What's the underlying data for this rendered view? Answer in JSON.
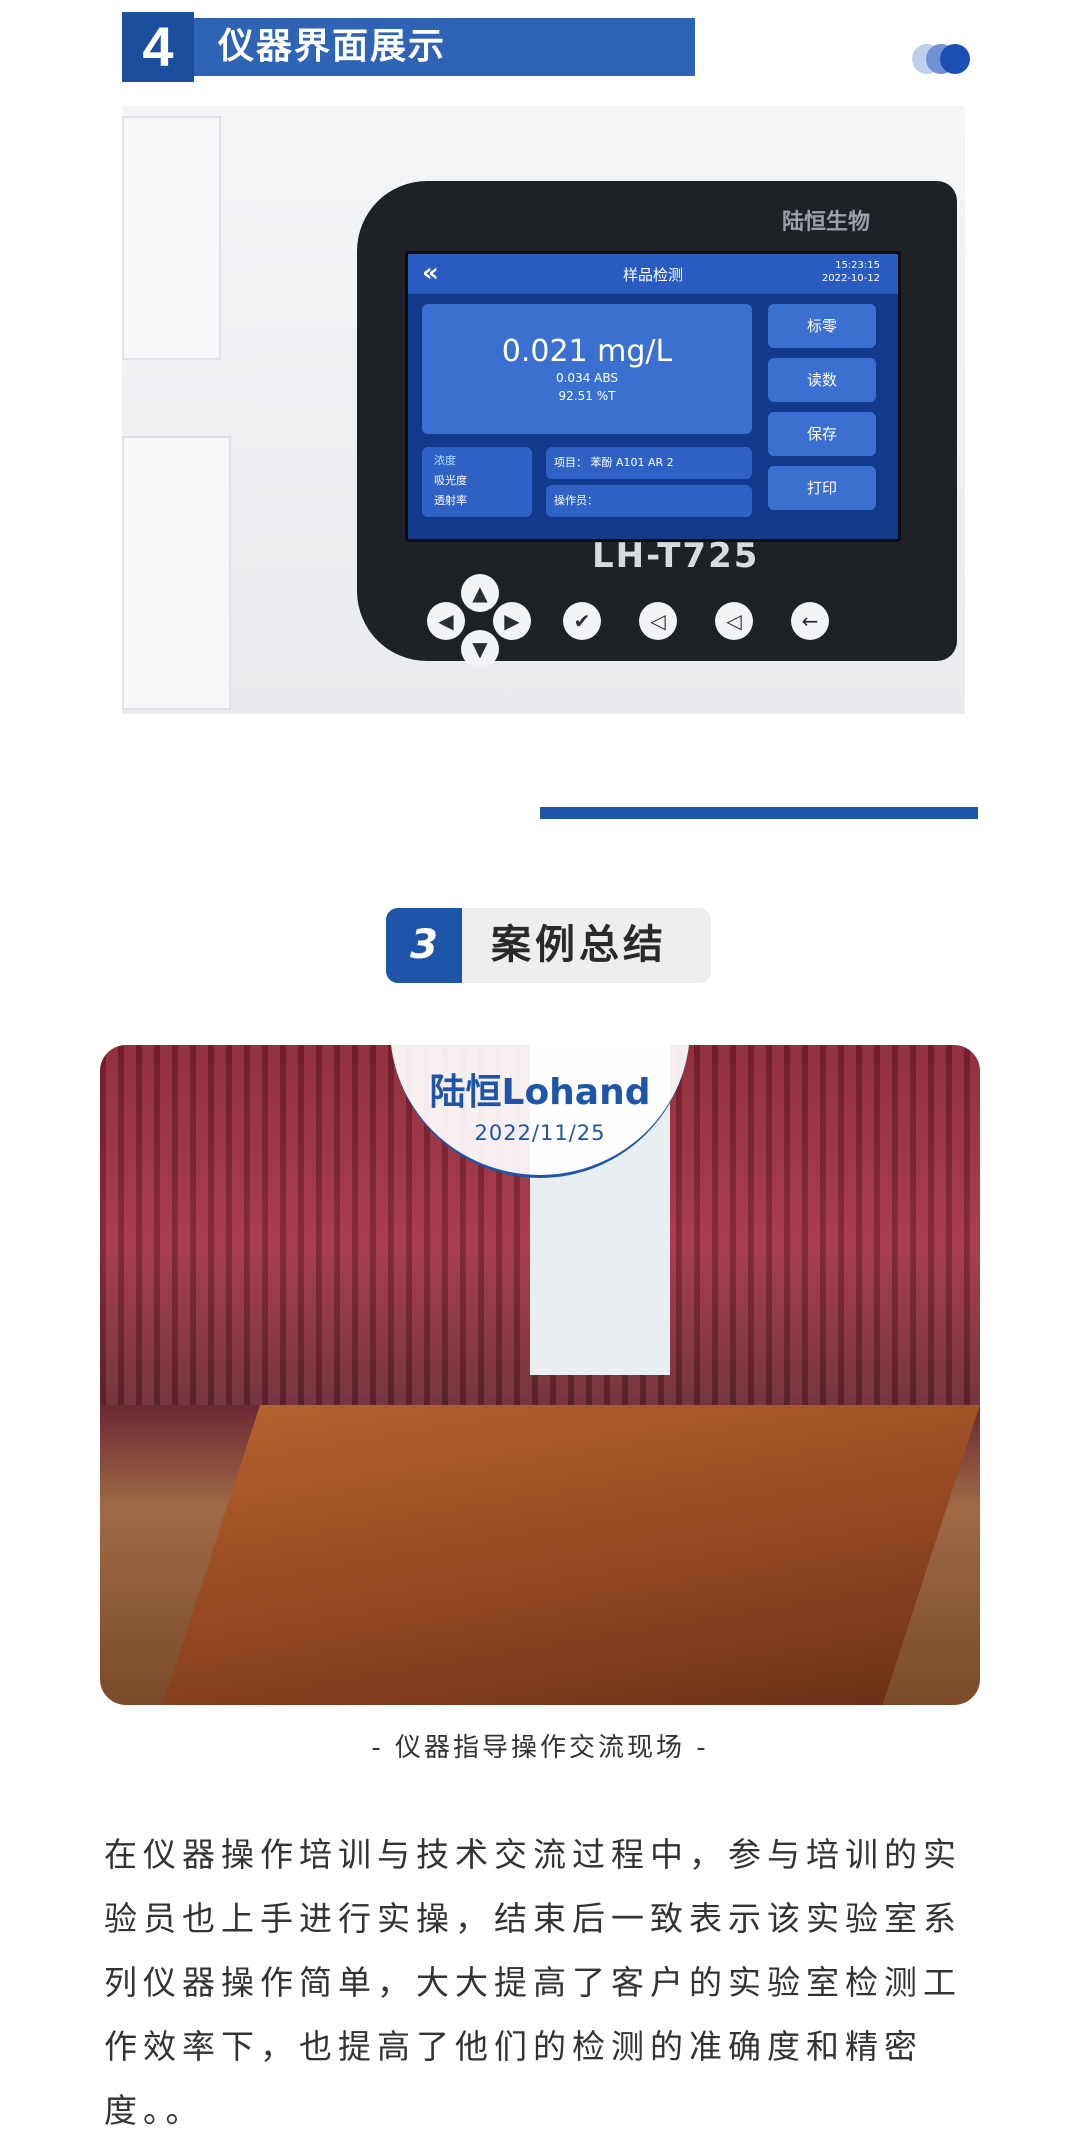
{
  "section4": {
    "number": "4",
    "title": "仪器界面展示"
  },
  "instrument": {
    "brand": "陆恒生物",
    "screen_title": "样品检测",
    "back_glyph": "«",
    "time": "15:23:15",
    "date": "2022-10-12",
    "concentration": "0.021 mg/L",
    "abs": "0.034  ABS",
    "transmittance": "92.51  %T",
    "buttons": [
      "标零",
      "读数",
      "保存",
      "打印"
    ],
    "modes": [
      "浓度",
      "吸光度",
      "透射率"
    ],
    "project": "项目：    苯酚 A101 AR 2",
    "operator": "操作员：",
    "model": "LH-T725",
    "keys": [
      "◀",
      "▲",
      "▶",
      "▼",
      "✔",
      "◁",
      "◁",
      "←"
    ]
  },
  "section3": {
    "number": "3",
    "title": "案例总结"
  },
  "photo_badge": {
    "brand": "陆恒Lohand",
    "date": "2022/11/25"
  },
  "caption": "- 仪器指导操作交流现场 -",
  "paragraph": "在仪器操作培训与技术交流过程中，参与培训的实验员也上手进行实操，结束后一致表示该实验室系列仪器操作简单，大大提高了客户的实验室检测工作效率下，也提高了他们的检测的准确度和精密度。。",
  "colors": {
    "primary": "#1f55a8",
    "header_blue": "#2f63b6"
  }
}
